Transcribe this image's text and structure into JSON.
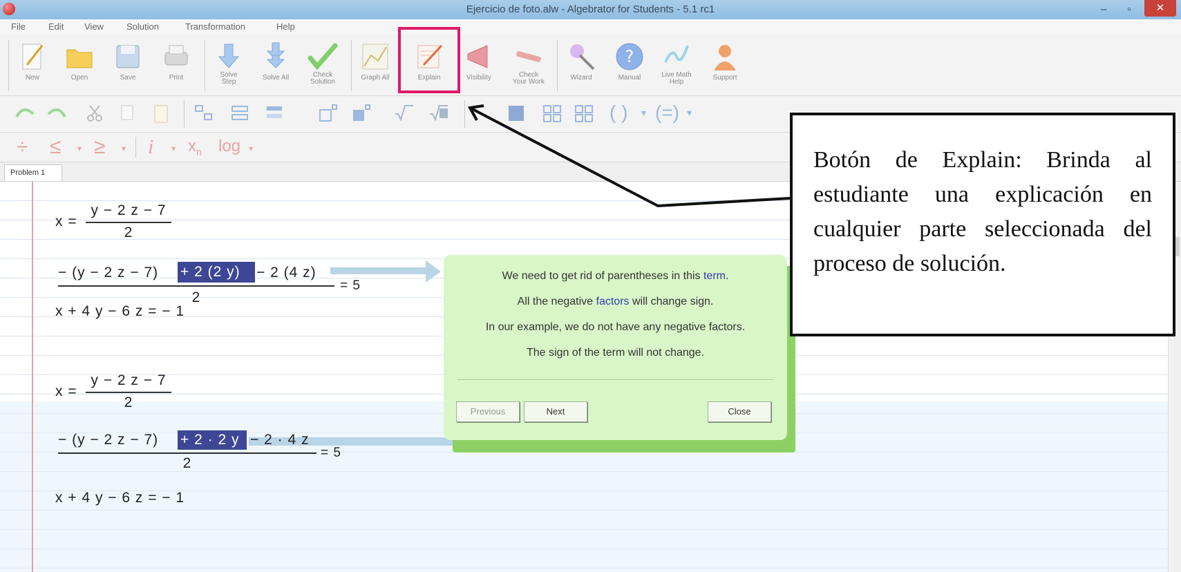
{
  "window": {
    "title": "Ejercicio de foto.alw - Algebrator for Students - 5.1 rc1",
    "minimize": "–",
    "maximize": "▫",
    "close": "✕"
  },
  "menu": [
    "File",
    "Edit",
    "View",
    "Solution",
    "Transformation",
    "Help"
  ],
  "toolbar": {
    "new": "New",
    "open": "Open",
    "save": "Save",
    "print": "Print",
    "solve_step_1": "Solve",
    "solve_step_2": "Step",
    "solve_all": "Solve All",
    "check_solution_1": "Check",
    "check_solution_2": "Solution",
    "graph_all": "Graph All",
    "explain": "Explain",
    "visibility": "Visibility",
    "check_work_1": "Check",
    "check_work_2": "Your Work",
    "wizard": "Wizard",
    "manual": "Manual",
    "live_help_1": "Live Math",
    "live_help_2": "Help",
    "support": "Support"
  },
  "toolbar2": {
    "parens": "( )",
    "paren_menu": "▾",
    "eq_parens": "(=)"
  },
  "toolbar3": {
    "divide": "÷",
    "leq": "≤",
    "geq": "≥",
    "imaginary": "i",
    "subscript": "x",
    "subscript_n": "n",
    "log": "log",
    "caret": "▾"
  },
  "tab": "Problem 1",
  "math": {
    "eq1": {
      "lhs": "x =",
      "num": "y − 2 z − 7",
      "den": "2"
    },
    "eq2": {
      "num_a": "− (y − 2 z − 7)",
      "num_hl": "+ 2 (2 y)",
      "num_b": "− 2 (4 z)",
      "den": "2",
      "rhs": "= 5"
    },
    "eq3": "x + 4 y − 6 z = − 1",
    "eq4": {
      "lhs": "x =",
      "num": "y − 2 z − 7",
      "den": "2"
    },
    "eq5": {
      "num_a": "− (y − 2 z − 7)",
      "num_hl": "+ 2 · 2 y",
      "num_b": "− 2 · 4 z",
      "den": "2",
      "rhs": "= 5"
    },
    "eq6": "x + 4 y − 6 z = − 1"
  },
  "popup": {
    "line1_a": "We need to get rid of parentheses in this ",
    "line1_kw": "term",
    "line1_b": ".",
    "line2_a": "All the negative ",
    "line2_kw": "factors",
    "line2_b": " will change sign.",
    "line3": "In our example, we do not have any negative factors.",
    "line4": "The sign of the term will not change.",
    "previous": "Previous",
    "next": "Next",
    "close": "Close"
  },
  "annotation": {
    "text": "Botón de Explain: Brinda al estudiante una explicación en cualquier parte seleccionada del proceso de solución."
  },
  "colors": {
    "highlight_box": "#e0186a",
    "popup_bg": "#d9f6c8",
    "selection": "#3d4796"
  }
}
